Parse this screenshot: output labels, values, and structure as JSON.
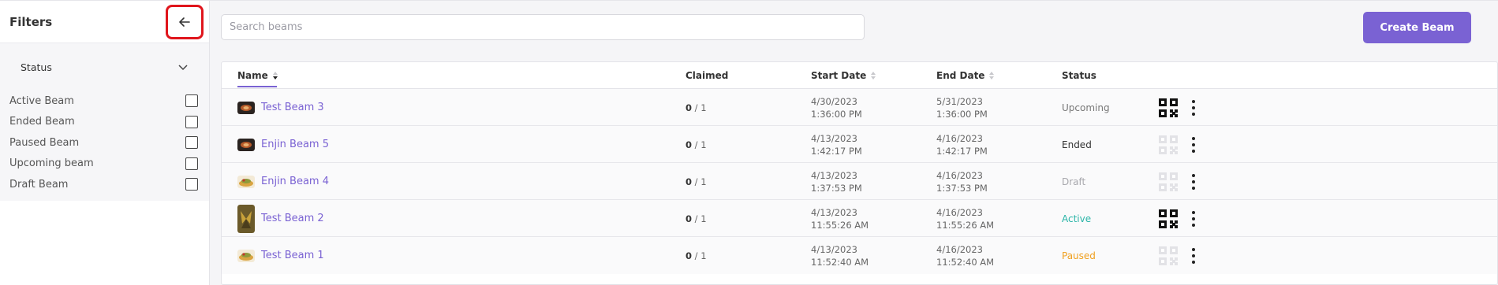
{
  "sidebar": {
    "title": "Filters",
    "back_icon": "arrow-left-icon",
    "section": {
      "title": "Status",
      "icon": "chevron-down-icon",
      "options": [
        "Active Beam",
        "Ended Beam",
        "Paused Beam",
        "Upcoming beam",
        "Draft Beam"
      ]
    }
  },
  "search": {
    "placeholder": "Search beams",
    "value": ""
  },
  "create_button": {
    "label": "Create Beam",
    "color": "#7a62d3"
  },
  "table": {
    "headers": {
      "name": "Name",
      "claimed": "Claimed",
      "start": "Start Date",
      "end": "End Date",
      "status": "Status"
    },
    "rows": [
      {
        "thumb": "dark-fire",
        "name": "Test Beam 3",
        "claimed_num": "0",
        "claimed_sep": " / 1",
        "start_date": "4/30/2023",
        "start_time": "1:36:00 PM",
        "end_date": "5/31/2023",
        "end_time": "1:36:00 PM",
        "status": "Upcoming",
        "status_color": "#777777",
        "qr_active": true
      },
      {
        "thumb": "dark-fire",
        "name": "Enjin Beam 5",
        "claimed_num": "0",
        "claimed_sep": " / 1",
        "start_date": "4/13/2023",
        "start_time": "1:42:17 PM",
        "end_date": "4/16/2023",
        "end_time": "1:42:17 PM",
        "status": "Ended",
        "status_color": "#333333",
        "qr_active": false
      },
      {
        "thumb": "food",
        "name": "Enjin Beam 4",
        "claimed_num": "0",
        "claimed_sep": " / 1",
        "start_date": "4/13/2023",
        "start_time": "1:37:53 PM",
        "end_date": "4/16/2023",
        "end_time": "1:37:53 PM",
        "status": "Draft",
        "status_color": "#a8a8ad",
        "qr_active": false
      },
      {
        "thumb": "butterfly",
        "name": "Test Beam 2",
        "claimed_num": "0",
        "claimed_sep": " / 1",
        "start_date": "4/13/2023",
        "start_time": "11:55:26 AM",
        "end_date": "4/16/2023",
        "end_time": "11:55:26 AM",
        "status": "Active",
        "status_color": "#2bb5a8",
        "qr_active": true
      },
      {
        "thumb": "food",
        "name": "Test Beam 1",
        "claimed_num": "0",
        "claimed_sep": " / 1",
        "start_date": "4/13/2023",
        "start_time": "11:52:40 AM",
        "end_date": "4/16/2023",
        "end_time": "11:52:40 AM",
        "status": "Paused",
        "status_color": "#f0a020",
        "qr_active": false
      }
    ]
  }
}
